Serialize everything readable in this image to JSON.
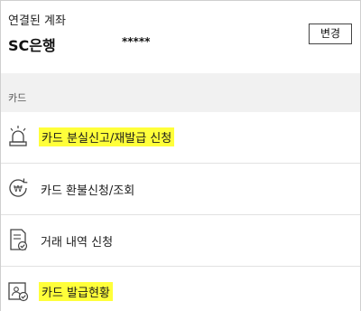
{
  "account": {
    "label": "연결된 계좌",
    "bank": "SC은행",
    "masked_number": "*****",
    "change_button": "변경"
  },
  "section": {
    "title": "카드"
  },
  "menu": {
    "items": [
      {
        "label": "카드 분실신고/재발급 신청",
        "icon": "siren-icon",
        "highlighted": true
      },
      {
        "label": "카드 환불신청/조회",
        "icon": "won-refund-icon",
        "highlighted": false
      },
      {
        "label": "거래 내역 신청",
        "icon": "document-check-icon",
        "highlighted": false
      },
      {
        "label": "카드 발급현황",
        "icon": "card-status-icon",
        "highlighted": true
      }
    ]
  },
  "colors": {
    "highlight": "#ffff3a",
    "section_background": "#f1f1f1",
    "divider": "#e2e2e2"
  }
}
